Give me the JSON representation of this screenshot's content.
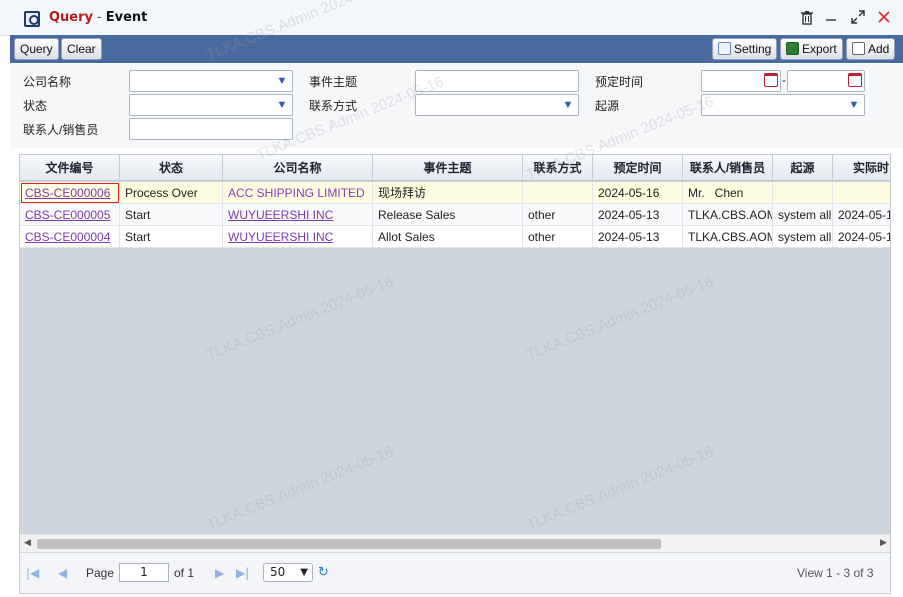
{
  "window": {
    "title_primary": "Query",
    "title_separator": "-",
    "title_secondary": "Event"
  },
  "toolbar": {
    "query_label": "Query",
    "clear_label": "Clear",
    "setting_label": "Setting",
    "export_label": "Export",
    "add_label": "Add"
  },
  "form": {
    "company_label": "公司名称",
    "status_label": "状态",
    "contact_label": "联系人/销售员",
    "subject_label": "事件主题",
    "contact_method_label": "联系方式",
    "scheduled_time_label": "预定时间",
    "source_label": "起源",
    "date_separator": "-"
  },
  "grid": {
    "columns": [
      "文件编号",
      "状态",
      "公司名称",
      "事件主题",
      "联系方式",
      "预定时间",
      "联系人/销售员",
      "起源",
      "实际时"
    ],
    "rows": [
      {
        "doc_no": "CBS-CE000006",
        "status": "Process Over",
        "company": "ACC SHIPPING LIMITED",
        "subject": "现场拜访",
        "method": "",
        "scheduled": "2024-05-16",
        "contact": "Mr.   Chen",
        "source": "",
        "actual": ""
      },
      {
        "doc_no": "CBS-CE000005",
        "status": "Start",
        "company": "WUYUEERSHI INC",
        "subject": "Release Sales",
        "method": "other",
        "scheduled": "2024-05-13",
        "contact": "TLKA.CBS.AOM",
        "source": "system all",
        "actual": "2024-05-1"
      },
      {
        "doc_no": "CBS-CE000004",
        "status": "Start",
        "company": "WUYUEERSHI INC",
        "subject": "Allot Sales",
        "method": "other",
        "scheduled": "2024-05-13",
        "contact": "TLKA.CBS.AOM",
        "source": "system all",
        "actual": "2024-05-1"
      }
    ]
  },
  "pager": {
    "page_label": "Page",
    "page_value": "1",
    "of_label": "of 1",
    "page_size": "50",
    "view_text": "View 1 - 3 of 3"
  },
  "watermark": "TLKA.CBS.Admin 2024-05-16",
  "colors": {
    "toolbar_bg": "#4a6a9e",
    "title_accent": "#b71c1c",
    "selected_row": "#fdfce0",
    "link": "#7b3aa8"
  },
  "icons": [
    "app-query-icon",
    "delete-icon",
    "minimize-icon",
    "maximize-icon",
    "close-icon",
    "setting-icon",
    "export-excel-icon",
    "add-icon",
    "calendar-icon",
    "chevron-down-icon",
    "first-page-icon",
    "prev-page-icon",
    "next-page-icon",
    "last-page-icon",
    "refresh-icon"
  ]
}
